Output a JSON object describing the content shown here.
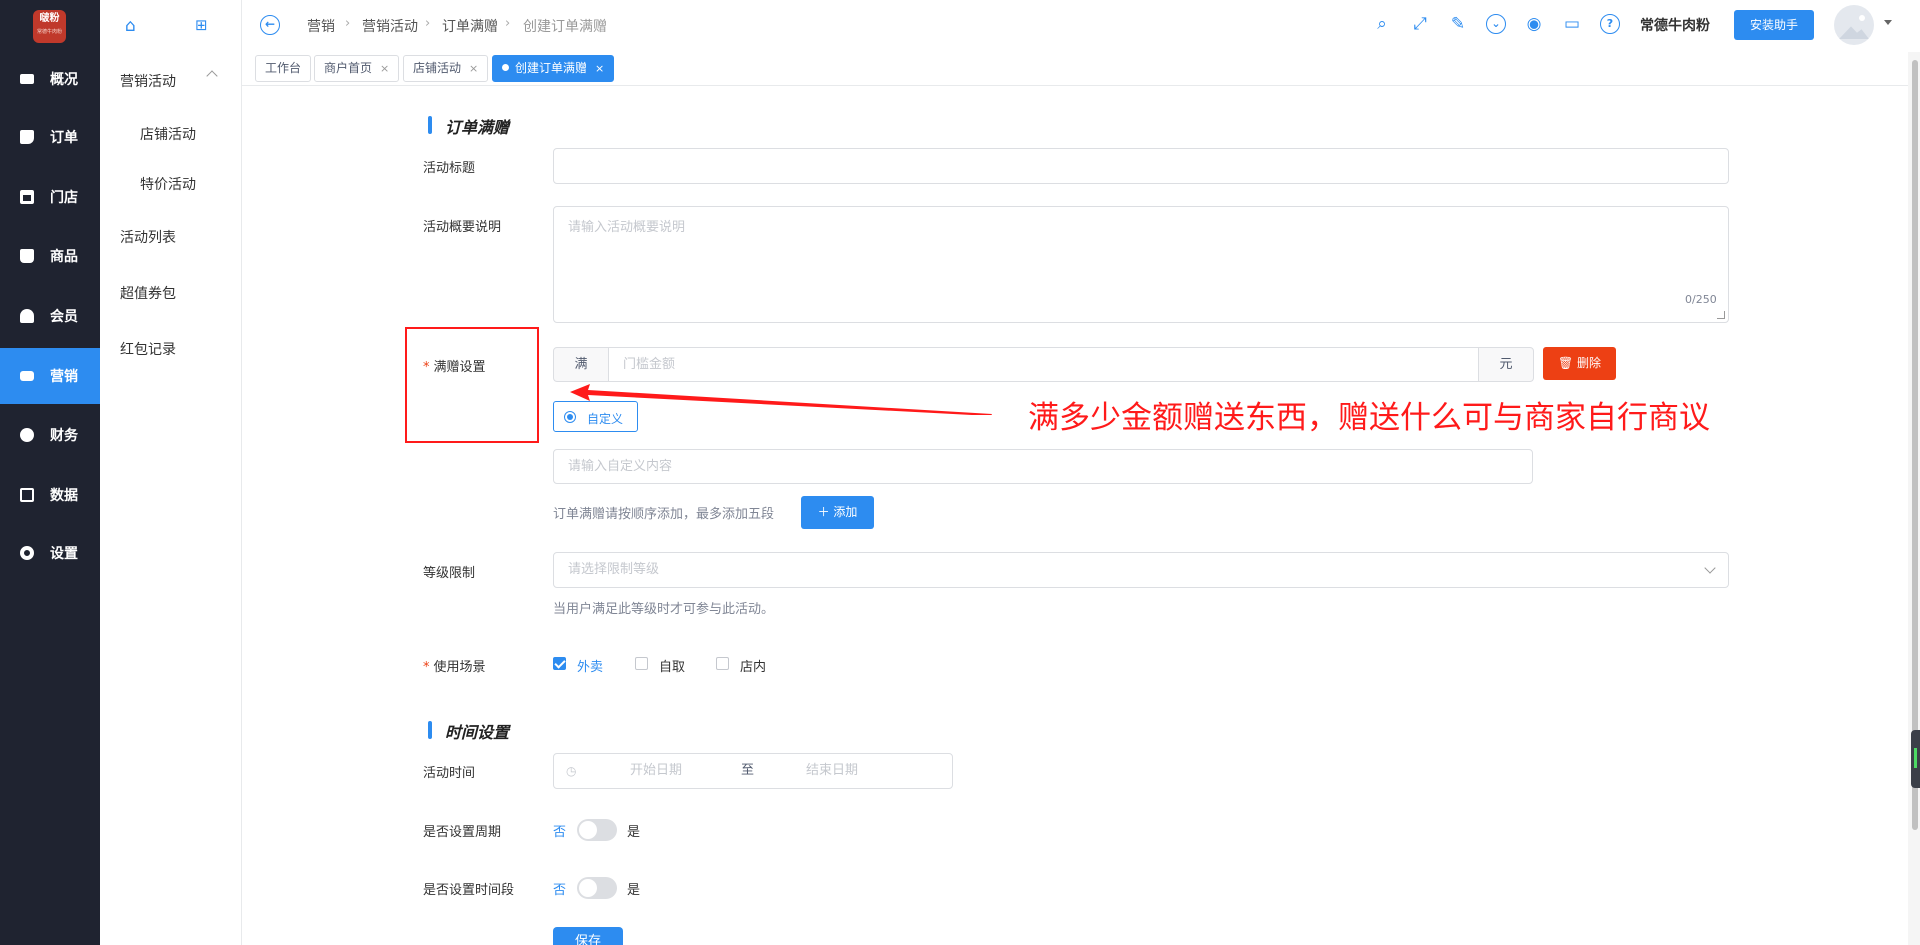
{
  "nav": {
    "logo_line1": "啵粉",
    "logo_line2": "常德牛肉粉",
    "items": [
      {
        "label": "概况",
        "icon": "overview-icon"
      },
      {
        "label": "订单",
        "icon": "order-icon"
      },
      {
        "label": "门店",
        "icon": "store-icon"
      },
      {
        "label": "商品",
        "icon": "goods-icon"
      },
      {
        "label": "会员",
        "icon": "member-icon"
      },
      {
        "label": "营销",
        "icon": "marketing-icon",
        "active": true
      },
      {
        "label": "财务",
        "icon": "finance-icon"
      },
      {
        "label": "数据",
        "icon": "data-icon"
      },
      {
        "label": "设置",
        "icon": "settings-icon"
      }
    ]
  },
  "subnav": {
    "group": "营销活动",
    "items": [
      "店铺活动",
      "特价活动"
    ],
    "other": [
      "活动列表",
      "超值券包",
      "红包记录"
    ]
  },
  "header": {
    "breadcrumb": [
      "营销",
      "营销活动",
      "订单满赠",
      "创建订单满赠"
    ],
    "shop_name": "常德牛肉粉",
    "install_button": "安装助手",
    "icons": [
      "search-icon",
      "fullscreen-icon",
      "brush-icon",
      "chevron-down-circle-icon",
      "eye-icon",
      "monitor-icon",
      "help-icon"
    ]
  },
  "tabs": [
    {
      "label": "工作台",
      "closable": false
    },
    {
      "label": "商户首页",
      "closable": true
    },
    {
      "label": "店铺活动",
      "closable": true
    },
    {
      "label": "创建订单满赠",
      "closable": true,
      "active": true
    }
  ],
  "form": {
    "section1_title": "订单满赠",
    "title_label": "活动标题",
    "title_value": "",
    "desc_label": "活动概要说明",
    "desc_placeholder": "请输入活动概要说明",
    "desc_counter": "0/250",
    "gift_label": "满赠设置",
    "gift_prefix": "满",
    "gift_placeholder": "门槛金额",
    "gift_suffix": "元",
    "delete_button": "删除",
    "custom_option": "自定义",
    "custom_placeholder": "请输入自定义内容",
    "add_hint": "订单满赠请按顺序添加，最多添加五段",
    "add_button": "添加",
    "level_label": "等级限制",
    "level_placeholder": "请选择限制等级",
    "level_hint": "当用户满足此等级时才可参与此活动。",
    "scene_label": "使用场景",
    "scenes": [
      {
        "label": "外卖",
        "checked": true
      },
      {
        "label": "自取",
        "checked": false
      },
      {
        "label": "店内",
        "checked": false
      }
    ],
    "section2_title": "时间设置",
    "time_label": "活动时间",
    "start_placeholder": "开始日期",
    "to_text": "至",
    "end_placeholder": "结束日期",
    "cycle_label": "是否设置周期",
    "period_label": "是否设置时间段",
    "switch_off": "否",
    "switch_on": "是",
    "save_button": "保存"
  },
  "annotation": {
    "text": "满多少金额赠送东西，赠送什么可与商家自行商议",
    "color": "#ff1a1a"
  },
  "colors": {
    "primary": "#2d8cf0",
    "danger": "#ed4014",
    "sidebar": "#1f2330"
  }
}
